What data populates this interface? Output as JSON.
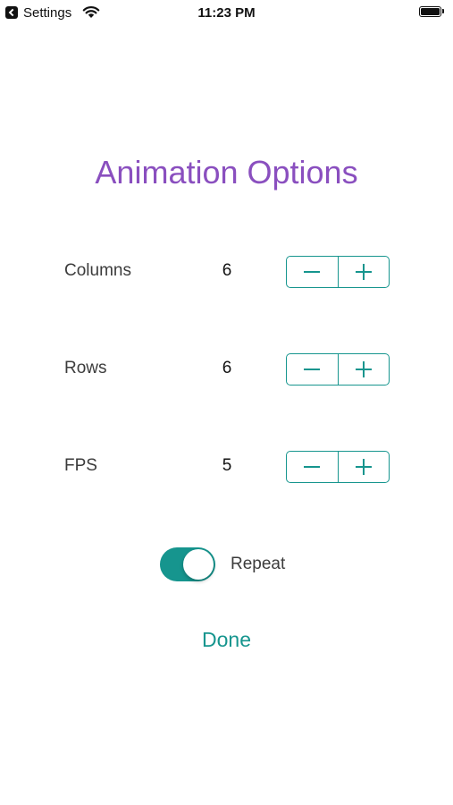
{
  "status_bar": {
    "back_label": "Settings",
    "time": "11:23 PM",
    "icons": [
      "back-arrow-icon",
      "wifi-icon",
      "battery-icon"
    ]
  },
  "title": "Animation Options",
  "options": [
    {
      "label": "Columns",
      "value": "6"
    },
    {
      "label": "Rows",
      "value": "6"
    },
    {
      "label": "FPS",
      "value": "5"
    }
  ],
  "stepper_icons": [
    "minus-icon",
    "plus-icon"
  ],
  "repeat": {
    "label": "Repeat",
    "on": true
  },
  "done_label": "Done",
  "colors": {
    "title": "#8a4fbf",
    "accent": "#16958e",
    "label_text": "#3c3c3c"
  }
}
